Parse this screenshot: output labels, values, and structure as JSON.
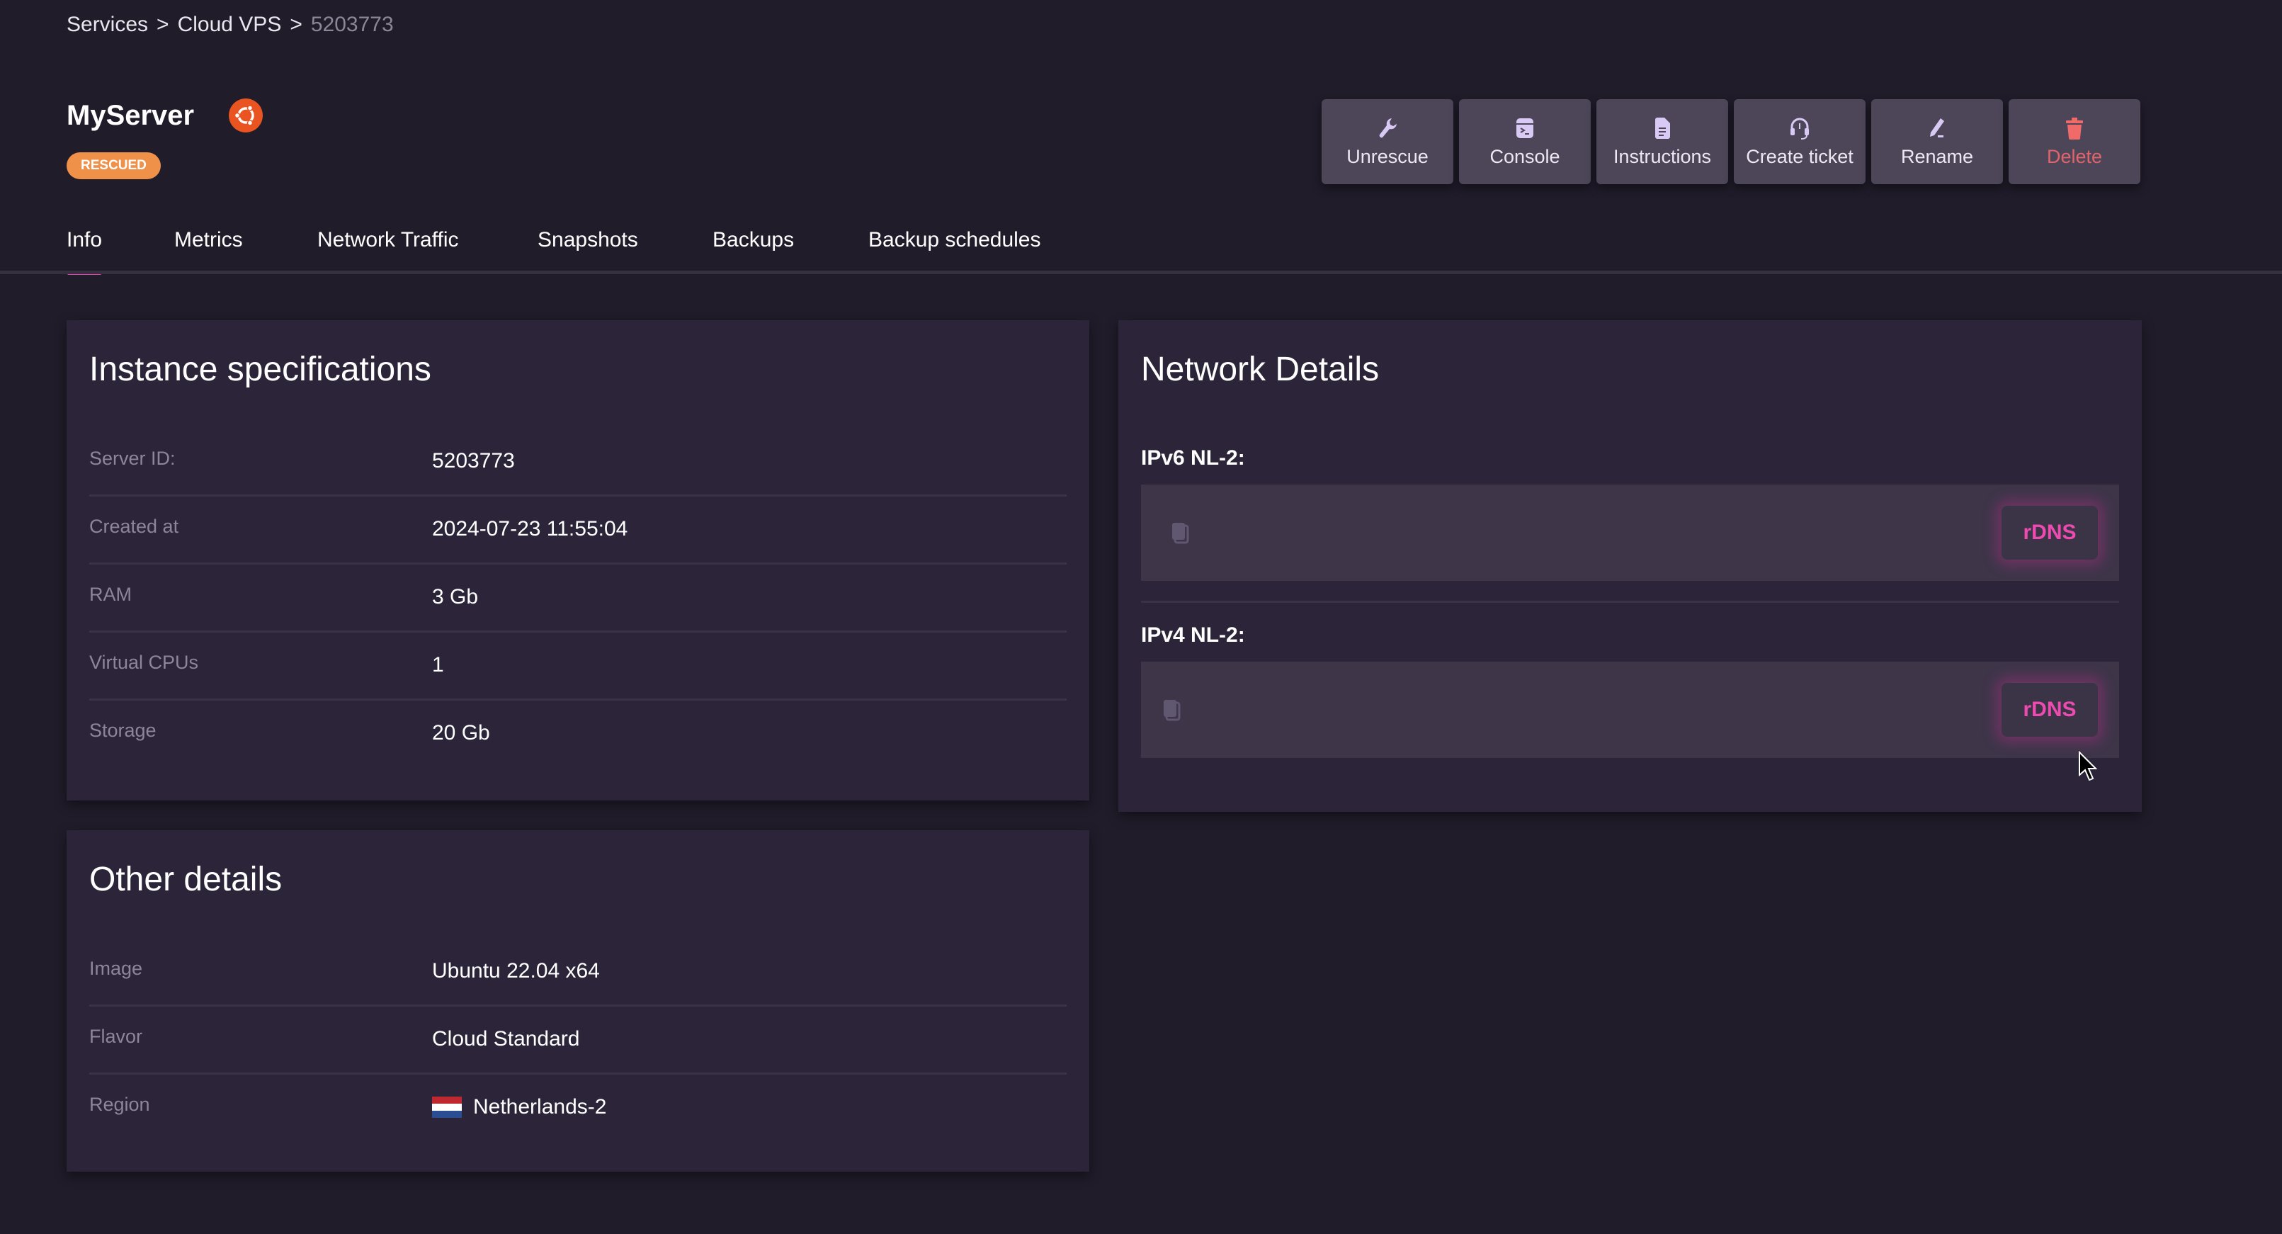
{
  "breadcrumb": {
    "items": [
      "Services",
      "Cloud VPS"
    ],
    "separator": ">",
    "current": "5203773"
  },
  "header": {
    "title": "MyServer",
    "os_icon": "ubuntu-logo-icon",
    "status_badge": "RESCUED",
    "colors": {
      "badge": "#f0914a",
      "os_icon": "#e95420"
    }
  },
  "actions": [
    {
      "label": "Unrescue",
      "icon": "wrench-icon"
    },
    {
      "label": "Console",
      "icon": "console-icon"
    },
    {
      "label": "Instructions",
      "icon": "document-icon"
    },
    {
      "label": "Create ticket",
      "icon": "headset-icon"
    },
    {
      "label": "Rename",
      "icon": "pen-icon"
    },
    {
      "label": "Delete",
      "icon": "trash-icon"
    }
  ],
  "tabs": [
    {
      "label": "Info",
      "active": true
    },
    {
      "label": "Metrics",
      "active": false
    },
    {
      "label": "Network Traffic",
      "active": false
    },
    {
      "label": "Snapshots",
      "active": false
    },
    {
      "label": "Backups",
      "active": false
    },
    {
      "label": "Backup schedules",
      "active": false
    }
  ],
  "instance_specs": {
    "title": "Instance specifications",
    "rows": [
      {
        "label": "Server ID:",
        "value": "5203773"
      },
      {
        "label": "Created at",
        "value": "2024-07-23 11:55:04"
      },
      {
        "label": "RAM",
        "value": "3 Gb"
      },
      {
        "label": "Virtual CPUs",
        "value": "1"
      },
      {
        "label": "Storage",
        "value": "20 Gb"
      }
    ]
  },
  "other_details": {
    "title": "Other details",
    "rows": [
      {
        "label": "Image",
        "value": "Ubuntu 22.04 x64"
      },
      {
        "label": "Flavor",
        "value": "Cloud Standard"
      },
      {
        "label": "Region",
        "value": "Netherlands-2",
        "flag": "netherlands-flag-icon"
      }
    ]
  },
  "network": {
    "title": "Network Details",
    "entries": [
      {
        "label": "IPv6 NL-2:",
        "address": "",
        "button": "rDNS"
      },
      {
        "label": "IPv4 NL-2:",
        "address": "",
        "button": "rDNS"
      }
    ],
    "accent": "#ec4bb0"
  }
}
